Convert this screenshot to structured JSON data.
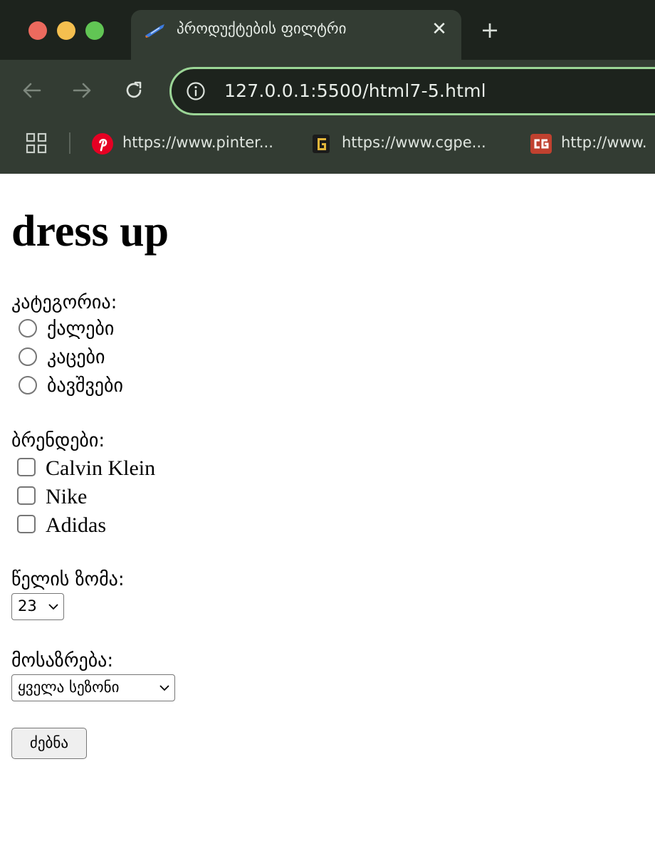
{
  "browser": {
    "tab": {
      "title": "პროდუქტების ფილტრი",
      "close_glyph": "✕",
      "favicon": "rocket-icon"
    },
    "new_tab_glyph": "+",
    "address_bar": {
      "url": "127.0.0.1:5500/html7-5.html",
      "info_icon": "info-icon"
    },
    "bookmarks": [
      {
        "label": "https://www.pinter...",
        "icon": "pinterest-icon"
      },
      {
        "label": "https://www.cgpe...",
        "icon": "cgpeers-icon"
      },
      {
        "label": "http://www.",
        "icon": "cg-icon"
      }
    ],
    "colors": {
      "accent": "#9bd596",
      "toolbar": "#333c33",
      "tabstrip": "#1d231d"
    }
  },
  "page": {
    "title": "dress up",
    "category": {
      "label": "კატეგორია:",
      "options": [
        "ქალები",
        "კაცები",
        "ბავშვები"
      ]
    },
    "brands": {
      "label": "ბრენდები:",
      "options": [
        "Calvin Klein",
        "Nike",
        "Adidas"
      ]
    },
    "waist_size": {
      "label": "წელის ზომა:",
      "selected": "23"
    },
    "season": {
      "label": "მოსაზრება:",
      "selected": "ყველა სეზონი"
    },
    "search_button": "ძებნა"
  }
}
